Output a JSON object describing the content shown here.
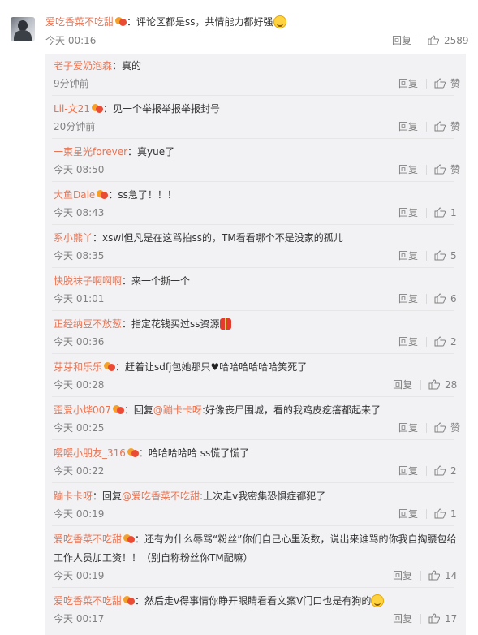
{
  "top_comment": {
    "user": "爱吃香菜不吃甜",
    "text": "：评论区都是ss，共情能力都好强",
    "time": "今天 00:16",
    "reply": "回复",
    "likes": "2589"
  },
  "replies": [
    {
      "user": "老子爱奶泡森",
      "badge": false,
      "text": "：真的",
      "time": "9分钟前",
      "like": "赞"
    },
    {
      "user": "Lil-文21",
      "badge": true,
      "text": "：见一个举报举报举报封号",
      "time": "20分钟前",
      "like": "赞"
    },
    {
      "user": "一束星光forever",
      "badge": false,
      "text": "：真yue了",
      "time": "今天 08:50",
      "like": "赞"
    },
    {
      "user": "大鱼Dale",
      "badge": true,
      "text": "：ss急了！！！",
      "time": "今天 08:43",
      "like": "1"
    },
    {
      "user": "系小熊丫",
      "badge": false,
      "text": "：xswl但凡是在这骂拍ss的，TM看看哪个不是没家的孤儿",
      "time": "今天 08:35",
      "like": "5"
    },
    {
      "user": "快脱袜子啊啊啊",
      "badge": false,
      "text": "：来一个撕一个",
      "time": "今天 01:01",
      "like": "6"
    },
    {
      "user": "正经纳豆不放葱",
      "badge": false,
      "text": "：指定花钱买过ss资源",
      "time": "今天 00:36",
      "like": "2"
    },
    {
      "user": "芽芽和乐乐",
      "badge": true,
      "text": "：赶着让sdfj包她那只",
      "text2": "哈哈哈哈哈哈笑死了",
      "time": "今天 00:28",
      "like": "28"
    },
    {
      "user": "歪爱小烨007",
      "badge": true,
      "text": "：回复",
      "mention": "@蹦卡卡呀",
      "text2": ":好像丧尸围城，看的我鸡皮疙瘩都起来了",
      "time": "今天 00:25",
      "like": "赞"
    },
    {
      "user": "嘤嘤小朋友_316",
      "badge": true,
      "text": "：哈哈哈哈哈 ss慌了慌了",
      "time": "今天 00:22",
      "like": "2"
    },
    {
      "user": "蹦卡卡呀",
      "badge": false,
      "text": "：回复",
      "mention": "@爱吃香菜不吃甜",
      "text2": ":上次走v我密集恐惧症都犯了",
      "time": "今天 00:19",
      "like": "1"
    },
    {
      "user": "爱吃香菜不吃甜",
      "badge": true,
      "text": "：还有为什么辱骂“粉丝”你们自己心里没数，说出来谁骂的你我自掏腰包给",
      "text_line2": "工作人员加工资！！（别自称粉丝你TM配嘛）",
      "time": "今天 00:19",
      "like": "14"
    },
    {
      "user": "爱吃香菜不吃甜",
      "badge": true,
      "text": "：然后走v得事情你睁开眼睛看看文案V门口也是有狗的",
      "time": "今天 00:17",
      "like": "17"
    }
  ],
  "reply_label": "回复",
  "icons": {
    "like": "thumb-up-icon",
    "badge": "member-badge-icon",
    "emoji": "smile-emoji-icon",
    "gift": "gift-icon",
    "heart": "heart-icon"
  },
  "colors": {
    "username": "#eb7350",
    "meta": "#808080",
    "panel": "#f2f2f5"
  }
}
